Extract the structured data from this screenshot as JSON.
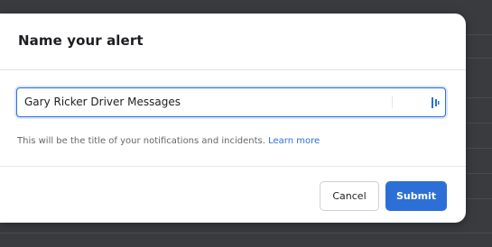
{
  "modal": {
    "title": "Name your alert",
    "input": {
      "value": "Gary Ricker Driver Messages",
      "placeholder": ""
    },
    "helper_text": "This will be the title of your notifications and incidents.",
    "learn_more_label": "Learn more",
    "buttons": {
      "cancel_label": "Cancel",
      "submit_label": "Submit"
    }
  },
  "colors": {
    "accent": "#2c6fd6",
    "overlay": "#3a3b3f",
    "modal_bg": "#ffffff",
    "text": "#1c1e21",
    "muted_text": "#65676b"
  },
  "icons": {
    "input_tool": "text-format-icon"
  }
}
